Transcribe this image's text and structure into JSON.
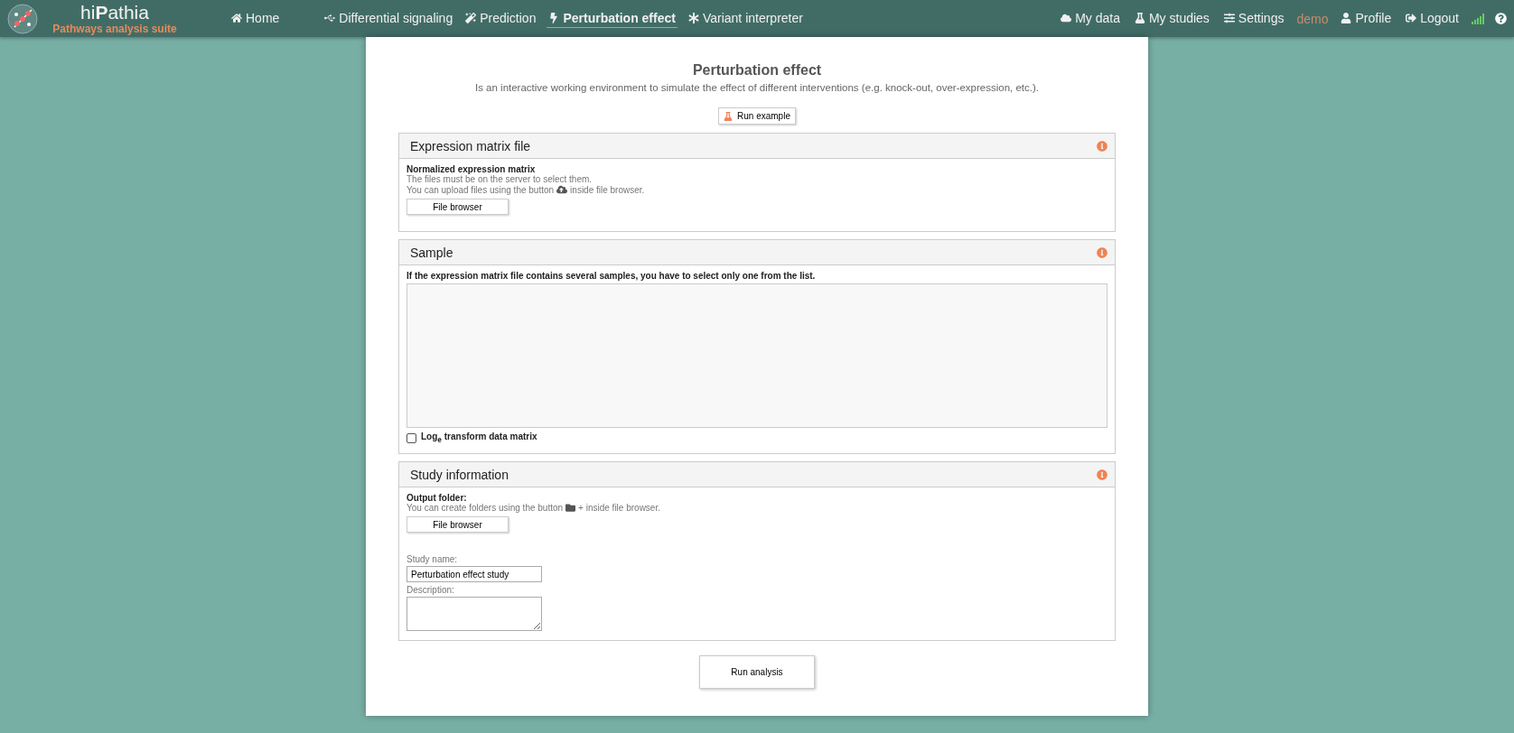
{
  "navbar": {
    "brand": "hi**P**athia",
    "subtitle": "Pathways analysis suite",
    "items": [
      {
        "label": "Home",
        "selected": false
      },
      {
        "label": "Differential signaling",
        "selected": false
      },
      {
        "label": "Prediction",
        "selected": false
      },
      {
        "label": "Perturbation effect",
        "selected": true
      },
      {
        "label": "Variant interpreter",
        "selected": false
      }
    ],
    "right_items": [
      {
        "kind": "link",
        "label": "My data"
      },
      {
        "kind": "link",
        "label": "My studies"
      },
      {
        "kind": "link",
        "label": "Settings"
      },
      {
        "kind": "user",
        "label": "demo"
      },
      {
        "kind": "link",
        "label": "Profile"
      },
      {
        "kind": "link",
        "label": "Logout"
      }
    ]
  },
  "page": {
    "title": "Perturbation effect",
    "description": "Is an interactive working environment to simulate the effect of different interventions (e.g. knock-out, over-expression, etc.).",
    "example_button": "Run example"
  },
  "sections": [
    {
      "kind": "file",
      "title": "Expression matrix file",
      "label": "Normalized expression matrix",
      "hint_1": "The files must be on the server to select them.",
      "hint_2_before": "You can upload files using the button",
      "hint_2_after": "inside file browser.",
      "button": "File browser"
    },
    {
      "kind": "sample",
      "title": "Sample",
      "label": "If the expression matrix file contains several samples, you have to select only one from the list.",
      "checkbox": {
        "label": "Log$_{e}$ transform data matrix",
        "checked": false
      }
    },
    {
      "kind": "study",
      "title": "Study information",
      "label": "Output folder:",
      "hint_before": "You can create folders using the button",
      "hint_after": "+ inside file browser.",
      "button": "File browser",
      "name_label": "Study name:",
      "name_value": "Perturbation effect study",
      "description_label": "Description:"
    }
  ],
  "run_button": "Run analysis"
}
